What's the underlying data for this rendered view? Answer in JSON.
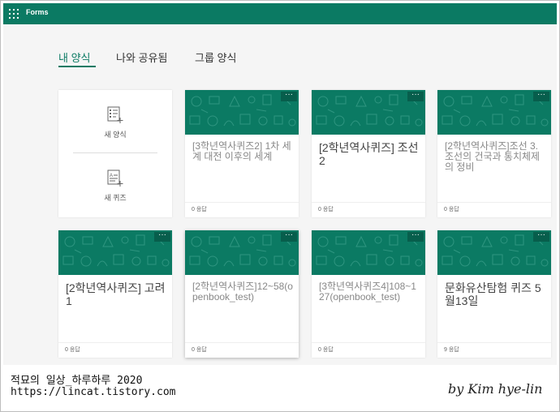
{
  "app": {
    "name": "Forms"
  },
  "tabs": [
    {
      "label": "내 양식",
      "active": true
    },
    {
      "label": "나와 공유됨",
      "active": false
    },
    {
      "label": "그룹 양식",
      "active": false
    }
  ],
  "new_actions": {
    "new_form": "새 양식",
    "new_quiz": "새 퀴즈"
  },
  "more_label": "···",
  "forms": [
    {
      "title": "[3학년역사퀴즈2] 1차 세계 대전 이후의 세계",
      "responses": "0 응답"
    },
    {
      "title": "[2학년역사퀴즈] 조선2",
      "responses": "0 응답"
    },
    {
      "title": "[2학년역사퀴즈]조선 3. 조선의 건국과 통치체제의 정비",
      "responses": "0 응답"
    },
    {
      "title": "[2학년역사퀴즈] 고려1",
      "responses": "0 응답"
    },
    {
      "title": "[2학년역사퀴즈]12~58(openbook_test)",
      "responses": "0 응답"
    },
    {
      "title": "[3학년역사퀴즈4]108~127(openbook_test)",
      "responses": "0 응답"
    },
    {
      "title": "문화유산탐험 퀴즈 5월13일",
      "responses": "9 응답"
    }
  ],
  "footer": {
    "line1": "적묘의 일상_하루하루 2020",
    "line2": "https://lincat.tistory.com",
    "signature": "by Kim hye-lin"
  },
  "colors": {
    "brand": "#0b7a63",
    "background": "#f5f5f5"
  },
  "icons": [
    "waffle-icon",
    "new-form-icon",
    "new-quiz-icon",
    "more-icon"
  ]
}
